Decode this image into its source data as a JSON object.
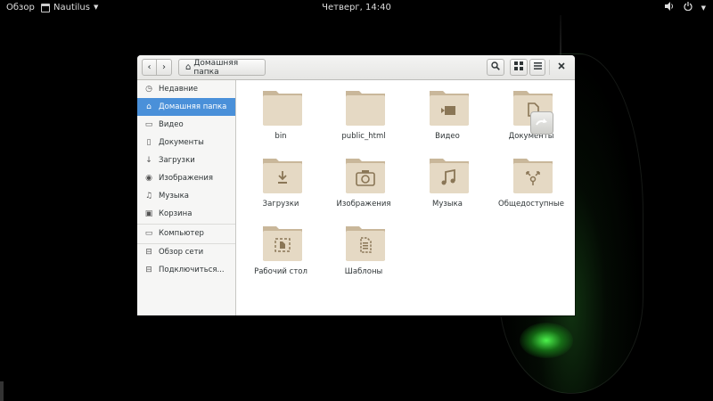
{
  "topbar": {
    "activities": "Обзор",
    "app_name": "Nautilus",
    "clock": "Четверг, 14:40"
  },
  "headerbar": {
    "back_glyph": "‹",
    "forward_glyph": "›",
    "path_label": "Домашняя папка",
    "search_glyph": "⚲",
    "view_glyph": "▦",
    "menu_glyph": "≡",
    "close_glyph": "×"
  },
  "sidebar": {
    "items": [
      {
        "label": "Недавние",
        "icon": "clock-icon",
        "glyph": "◷"
      },
      {
        "label": "Домашняя папка",
        "icon": "home-icon",
        "glyph": "⌂",
        "active": true
      },
      {
        "label": "Видео",
        "icon": "video-icon",
        "glyph": "▭"
      },
      {
        "label": "Документы",
        "icon": "document-icon",
        "glyph": "▯"
      },
      {
        "label": "Загрузки",
        "icon": "download-icon",
        "glyph": "↓"
      },
      {
        "label": "Изображения",
        "icon": "camera-icon",
        "glyph": "◉"
      },
      {
        "label": "Музыка",
        "icon": "music-icon",
        "glyph": "♫"
      },
      {
        "label": "Корзина",
        "icon": "trash-icon",
        "glyph": "▣"
      },
      {
        "label": "Компьютер",
        "icon": "drive-icon",
        "glyph": "▭"
      },
      {
        "label": "Обзор сети",
        "icon": "network-icon",
        "glyph": "⊟"
      },
      {
        "label": "Подключиться...",
        "icon": "connect-icon",
        "glyph": "⊟"
      }
    ]
  },
  "files": [
    {
      "label": "bin",
      "emblem": "none"
    },
    {
      "label": "public_html",
      "emblem": "none"
    },
    {
      "label": "Видео",
      "emblem": "video"
    },
    {
      "label": "Документы",
      "emblem": "document"
    },
    {
      "label": "Загрузки",
      "emblem": "download"
    },
    {
      "label": "Изображения",
      "emblem": "camera"
    },
    {
      "label": "Музыка",
      "emblem": "music"
    },
    {
      "label": "Общедоступные",
      "emblem": "share"
    },
    {
      "label": "Рабочий стол",
      "emblem": "desktop"
    },
    {
      "label": "Шаблоны",
      "emblem": "template"
    }
  ],
  "colors": {
    "accent": "#4a90d9",
    "folder_back": "#c9b79a",
    "folder_front": "#e5d9c4",
    "emblem": "#8a7656"
  }
}
